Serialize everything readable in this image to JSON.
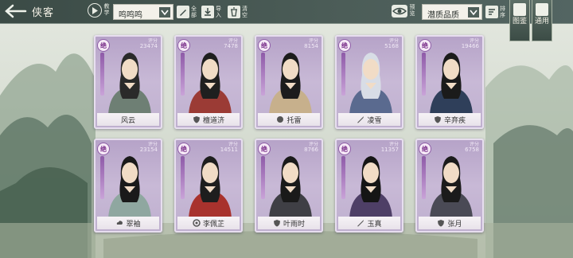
{
  "header": {
    "title": "侠客",
    "play_label": "教学",
    "filter_value": "鸣鸣鸣",
    "tools": [
      {
        "label": "全部",
        "icon": "brush-icon"
      },
      {
        "label": "导入",
        "icon": "import-icon"
      },
      {
        "label": "清空",
        "icon": "trash-icon"
      }
    ],
    "preview_label": "预览",
    "sort_value": "潜质品质",
    "sort_order_label": "排序"
  },
  "side_buttons": [
    {
      "label": "图鉴",
      "icon": "book-icon"
    },
    {
      "label": "通用",
      "icon": "scroll-icon"
    }
  ],
  "cards": [
    {
      "name": "风云",
      "badge": "绝",
      "power_label": "评分",
      "power": "23474",
      "sect": ""
    },
    {
      "name": "檀道济",
      "badge": "绝",
      "power_label": "评分",
      "power": "7478",
      "sect": "shield"
    },
    {
      "name": "托雷",
      "badge": "绝",
      "power_label": "评分",
      "power": "8154",
      "sect": "fist"
    },
    {
      "name": "凌雪",
      "badge": "绝",
      "power_label": "评分",
      "power": "5168",
      "sect": "blade"
    },
    {
      "name": "辛弃疾",
      "badge": "绝",
      "power_label": "评分",
      "power": "19466",
      "sect": "shield"
    },
    {
      "name": "翠袖",
      "badge": "绝",
      "power_label": "评分",
      "power": "23154",
      "sect": "cloud"
    },
    {
      "name": "李佩芷",
      "badge": "绝",
      "power_label": "评分",
      "power": "14511",
      "sect": "swirl"
    },
    {
      "name": "叶雨时",
      "badge": "绝",
      "power_label": "评分",
      "power": "8766",
      "sect": "shield"
    },
    {
      "name": "玉真",
      "badge": "绝",
      "power_label": "评分",
      "power": "11357",
      "sect": "blade"
    },
    {
      "name": "张月",
      "badge": "绝",
      "power_label": "评分",
      "power": "6758",
      "sect": "shield"
    }
  ],
  "colors": {
    "topbar": "#3b4b46",
    "card_purple": "#b6a3c8",
    "badge_purple": "#7a2f8a"
  }
}
